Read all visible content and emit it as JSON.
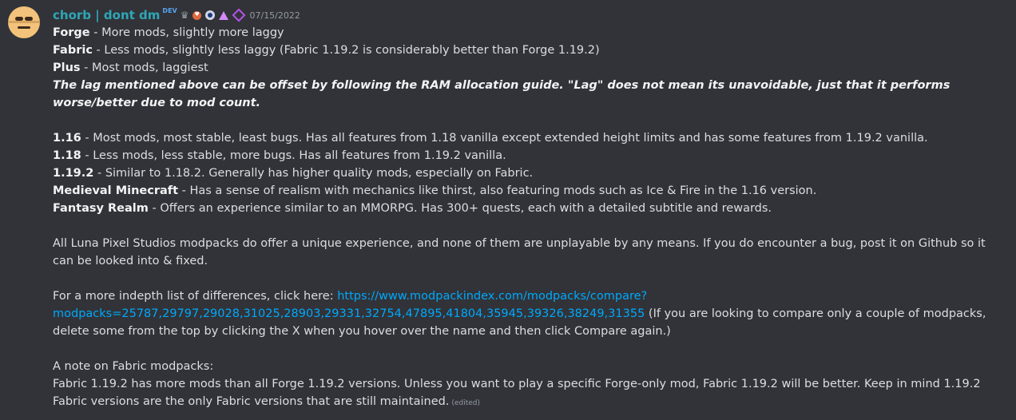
{
  "message": {
    "username": "chorb | dont dm",
    "dev_tag": "DEV",
    "timestamp": "07/15/2022",
    "badges": [
      "crown-icon",
      "heart-icon",
      "eye-icon",
      "triangle-icon",
      "gem-icon"
    ],
    "lines": {
      "forge_label": "Forge",
      "forge_text": " - More mods, slightly more laggy",
      "fabric_label": "Fabric",
      "fabric_text": " - Less mods, slightly less laggy (Fabric 1.19.2 is considerably better than Forge 1.19.2)",
      "plus_label": "Plus",
      "plus_text": " - Most mods, laggiest",
      "lag_note": "The lag mentioned above can be offset by following the RAM allocation guide. \"Lag\" does not mean its unavoidable, just that it performs worse/better due to mod count.",
      "v116_label": "1.16",
      "v116_text": " - Most mods, most stable, least bugs. Has all features from 1.18 vanilla except extended height limits and has some features from 1.19.2 vanilla.",
      "v118_label": "1.18",
      "v118_text": " - Less mods, less stable, more bugs. Has all features from 1.19.2 vanilla.",
      "v1192_label": "1.19.2",
      "v1192_text": " - Similar to 1.18.2. Generally has higher quality mods, especially on Fabric.",
      "medieval_label": "Medieval Minecraft",
      "medieval_text": " - Has a sense of realism with mechanics like thirst, also featuring mods such as Ice & Fire in the 1.16 version.",
      "fantasy_label": "Fantasy Realm",
      "fantasy_text": " - Offers an experience similar to an MMORPG. Has 300+ quests, each with a detailed subtitle and rewards.",
      "luna_paragraph": "All Luna Pixel Studios modpacks do offer a unique experience, and none of them are unplayable by any means. If you do encounter a bug, post it on Github so it can be looked into & fixed.",
      "indepth_prefix": "For a more indepth list of differences, click here: ",
      "indepth_link": "https://www.modpackindex.com/modpacks/compare?modpacks=25787,29797,29028,31025,28903,29331,32754,47895,41804,35945,39326,38249,31355",
      "indepth_suffix": " (If you are looking to compare only a couple of modpacks, delete some from the top by clicking the X when you hover over the name and then click Compare again.)",
      "fabric_note_title": "A note on Fabric modpacks:",
      "fabric_note_text": "Fabric 1.19.2 has more mods than all Forge 1.19.2 versions. Unless you want to play a specific Forge-only mod, Fabric 1.19.2 will be better. Keep in mind 1.19.2 Fabric versions are the only Fabric versions that are still maintained.",
      "edited": "(edited)"
    }
  },
  "colors": {
    "background": "#313338",
    "username": "#2ea7b6",
    "link": "#00a8fc",
    "text": "#dbdee1",
    "muted": "#949ba4"
  }
}
